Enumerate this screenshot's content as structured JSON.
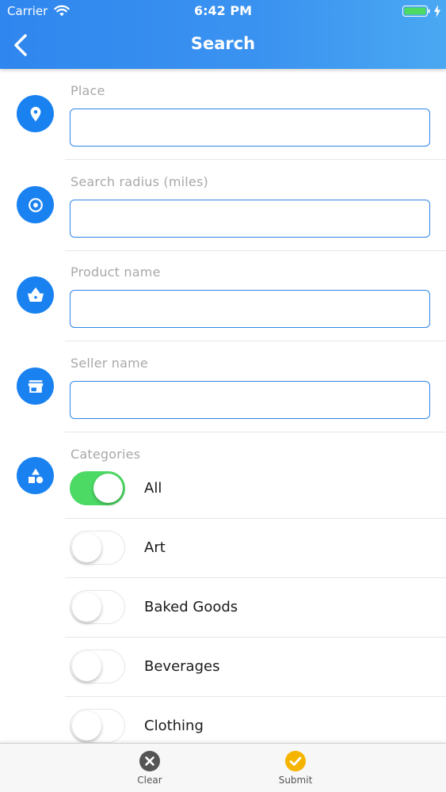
{
  "status_bar": {
    "carrier": "Carrier",
    "time": "6:42 PM"
  },
  "header": {
    "title": "Search"
  },
  "form": {
    "place_label": "Place",
    "place_value": "",
    "radius_label": "Search radius (miles)",
    "radius_value": "",
    "product_label": "Product name",
    "product_value": "",
    "seller_label": "Seller name",
    "seller_value": "",
    "categories_label": "Categories"
  },
  "categories": [
    {
      "label": "All",
      "on": true
    },
    {
      "label": "Art",
      "on": false
    },
    {
      "label": "Baked Goods",
      "on": false
    },
    {
      "label": "Beverages",
      "on": false
    },
    {
      "label": "Clothing",
      "on": false
    }
  ],
  "bottom_bar": {
    "clear_label": "Clear",
    "submit_label": "Submit"
  },
  "colors": {
    "header": "#3b93f0",
    "icon_circle": "#1a82f0",
    "toggle_on": "#4cd964",
    "clear_icon": "#555555",
    "submit_icon": "#f5b400"
  },
  "icons": {
    "place": "map-pin-icon",
    "radius": "target-icon",
    "product": "basket-icon",
    "seller": "storefront-icon",
    "categories": "shapes-icon",
    "clear": "close-circle-icon",
    "submit": "check-circle-icon"
  }
}
